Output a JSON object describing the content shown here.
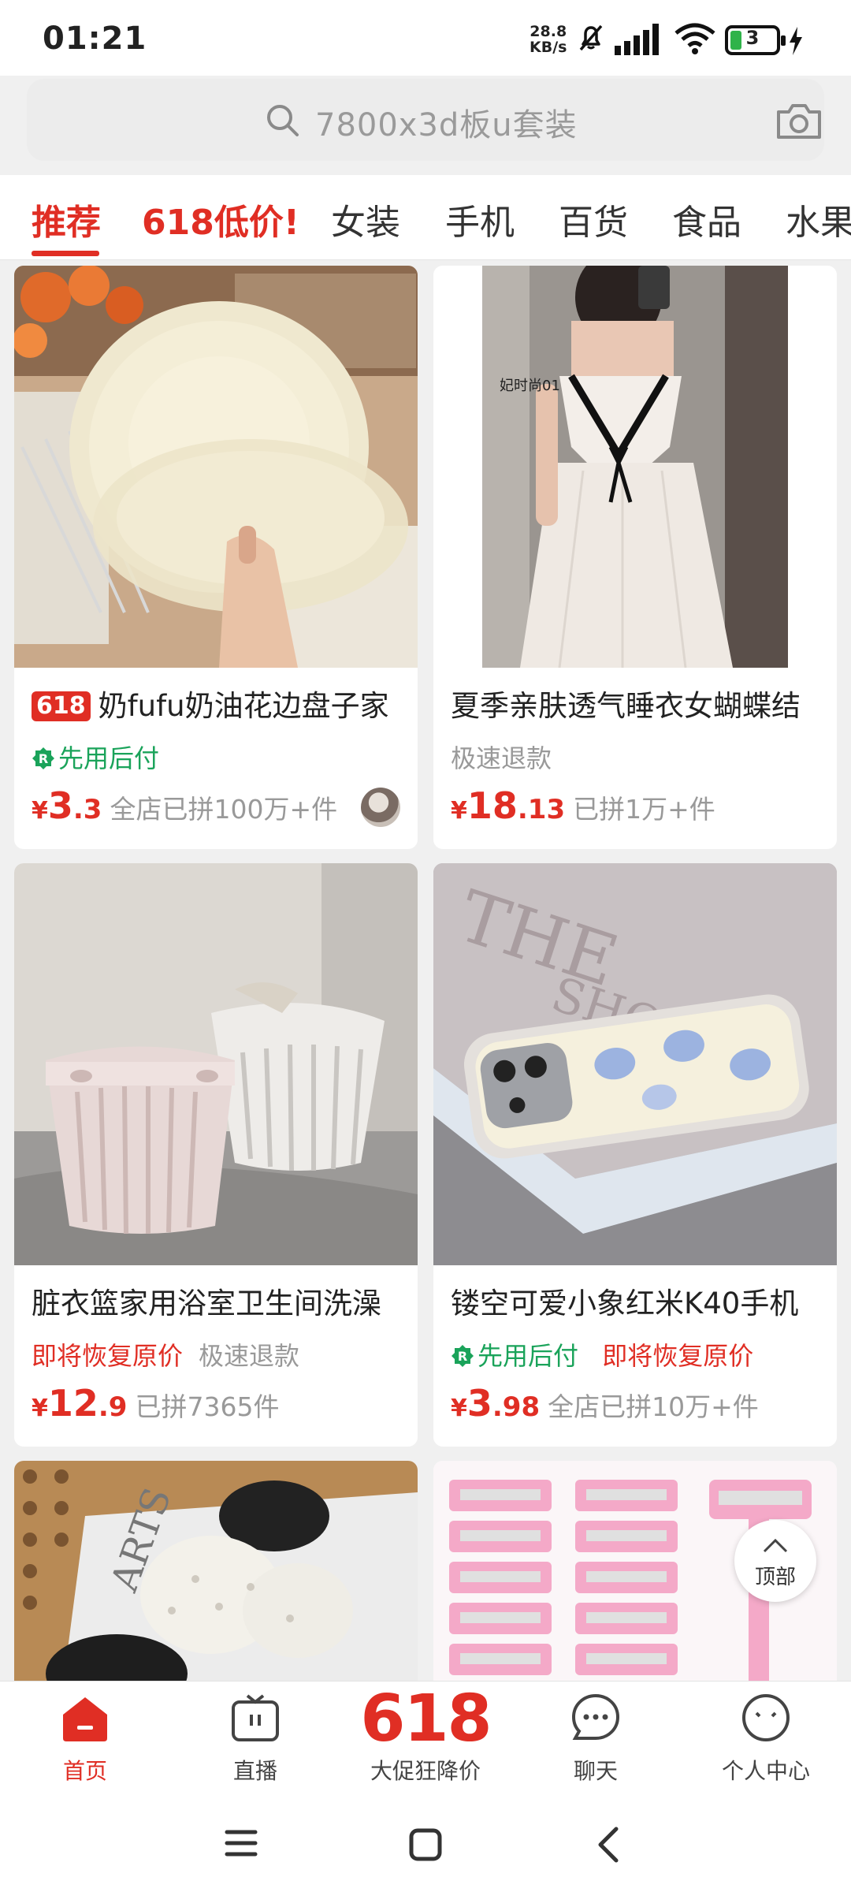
{
  "status_bar": {
    "time": "01:21",
    "net_speed_value": "28.8",
    "net_speed_unit": "KB/s",
    "battery_level": "3"
  },
  "search": {
    "placeholder": "7800x3d板u套装"
  },
  "tabs": [
    {
      "label": "推荐",
      "active": true
    },
    {
      "label": "618低价!",
      "active": false
    },
    {
      "label": "女装",
      "active": false
    },
    {
      "label": "手机",
      "active": false
    },
    {
      "label": "百货",
      "active": false
    },
    {
      "label": "食品",
      "active": false
    },
    {
      "label": "水果",
      "active": false
    }
  ],
  "products": [
    {
      "badge": "618",
      "title": "奶fufu奶油花边盘子家",
      "tags": [
        "先用后付"
      ],
      "price_int": "3",
      "price_dec": ".3",
      "currency": "¥",
      "sold": "全店已拼100万+件"
    },
    {
      "title": "夏季亲肤透气睡衣女蝴蝶结",
      "tags": [
        "极速退款"
      ],
      "image_text": "妃时尚01",
      "price_int": "18",
      "price_dec": ".13",
      "currency": "¥",
      "sold": "已拼1万+件"
    },
    {
      "title": "脏衣篮家用浴室卫生间洗澡",
      "tags": [
        "即将恢复原价",
        "极速退款"
      ],
      "price_int": "12",
      "price_dec": ".9",
      "currency": "¥",
      "sold": "已拼7365件"
    },
    {
      "title": "镂空可爱小象红米K40手机",
      "tags": [
        "先用后付",
        "即将恢复原价"
      ],
      "price_int": "3",
      "price_dec": ".98",
      "currency": "¥",
      "sold": "全店已拼10万+件"
    }
  ],
  "back_to_top": "顶部",
  "bottom_nav": [
    {
      "label": "首页",
      "active": true
    },
    {
      "label": "直播",
      "active": false
    },
    {
      "label": "618",
      "sub": "大促狂降价",
      "active": false
    },
    {
      "label": "聊天",
      "active": false
    },
    {
      "label": "个人中心",
      "active": false
    }
  ],
  "colors": {
    "accent": "#e02e24",
    "green": "#1aa35a",
    "muted": "#999999"
  }
}
